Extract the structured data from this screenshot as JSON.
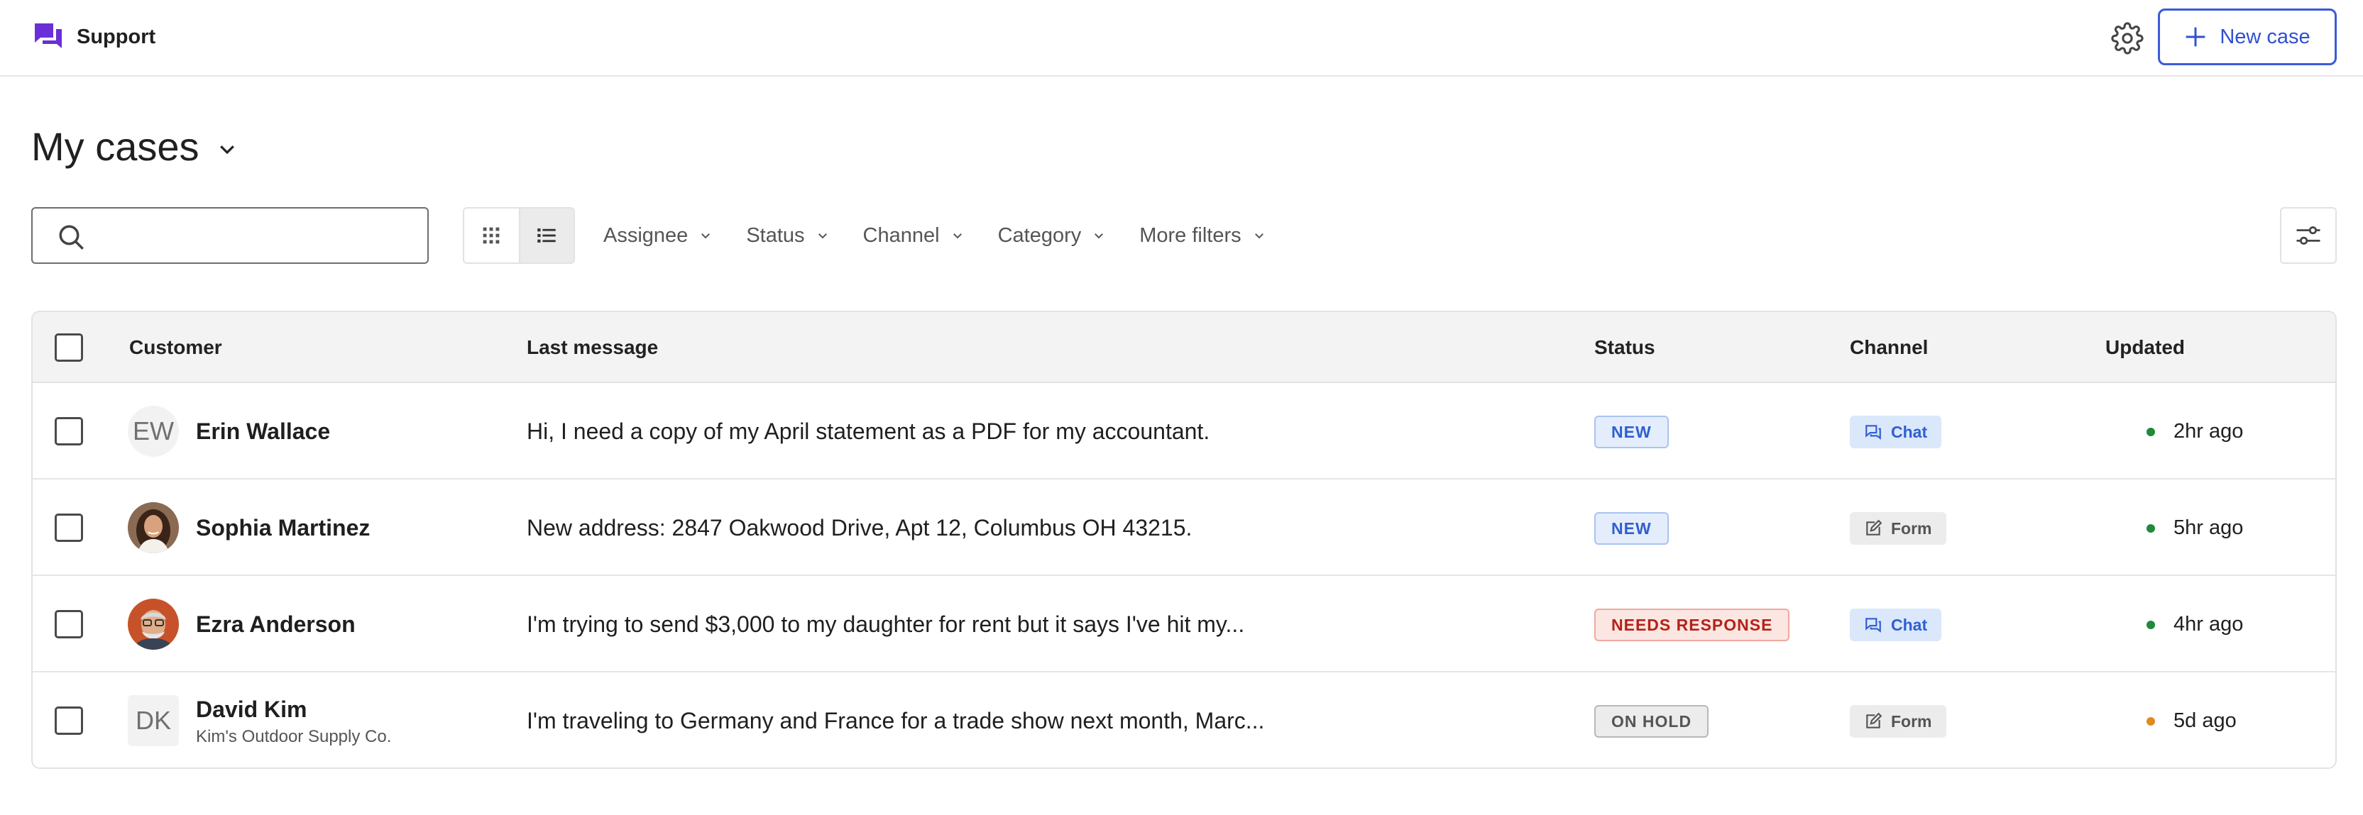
{
  "header": {
    "app_title": "Support",
    "new_case_label": "New case",
    "accent": "#3a5bd9",
    "logo_color": "#6a2fd6"
  },
  "page": {
    "title": "My cases"
  },
  "search": {
    "value": "",
    "placeholder": ""
  },
  "filters": [
    "Assignee",
    "Status",
    "Channel",
    "Category",
    "More filters"
  ],
  "table": {
    "columns": {
      "customer": "Customer",
      "last_message": "Last message",
      "status": "Status",
      "channel": "Channel",
      "updated": "Updated"
    },
    "rows": [
      {
        "initials": "EW",
        "name": "Erin Wallace",
        "company": "",
        "message": "Hi, I need a copy of my April statement as a PDF for my accountant.",
        "status": "NEW",
        "channel": "Chat",
        "updated": "2hr ago",
        "dot_color": "#1e8a3a"
      },
      {
        "initials": "",
        "name": "Sophia Martinez",
        "company": "",
        "message": "New address: 2847 Oakwood Drive, Apt 12, Columbus OH 43215.",
        "status": "NEW",
        "channel": "Form",
        "updated": "5hr ago",
        "dot_color": "#1e8a3a"
      },
      {
        "initials": "",
        "name": "Ezra Anderson",
        "company": "",
        "message": "I'm trying to send $3,000 to my daughter for rent but it says I've hit my...",
        "status": "NEEDS RESPONSE",
        "channel": "Chat",
        "updated": "4hr ago",
        "dot_color": "#1e8a3a"
      },
      {
        "initials": "DK",
        "name": "David Kim",
        "company": "Kim's Outdoor Supply Co.",
        "message": "I'm traveling to Germany and France for a trade show next month, Marc...",
        "status": "ON HOLD",
        "channel": "Form",
        "updated": "5d ago",
        "dot_color": "#e08a1e"
      }
    ]
  },
  "status_colors": {
    "new": "#2f5fd0",
    "needs_response": "#b42318",
    "on_hold": "#555555"
  }
}
